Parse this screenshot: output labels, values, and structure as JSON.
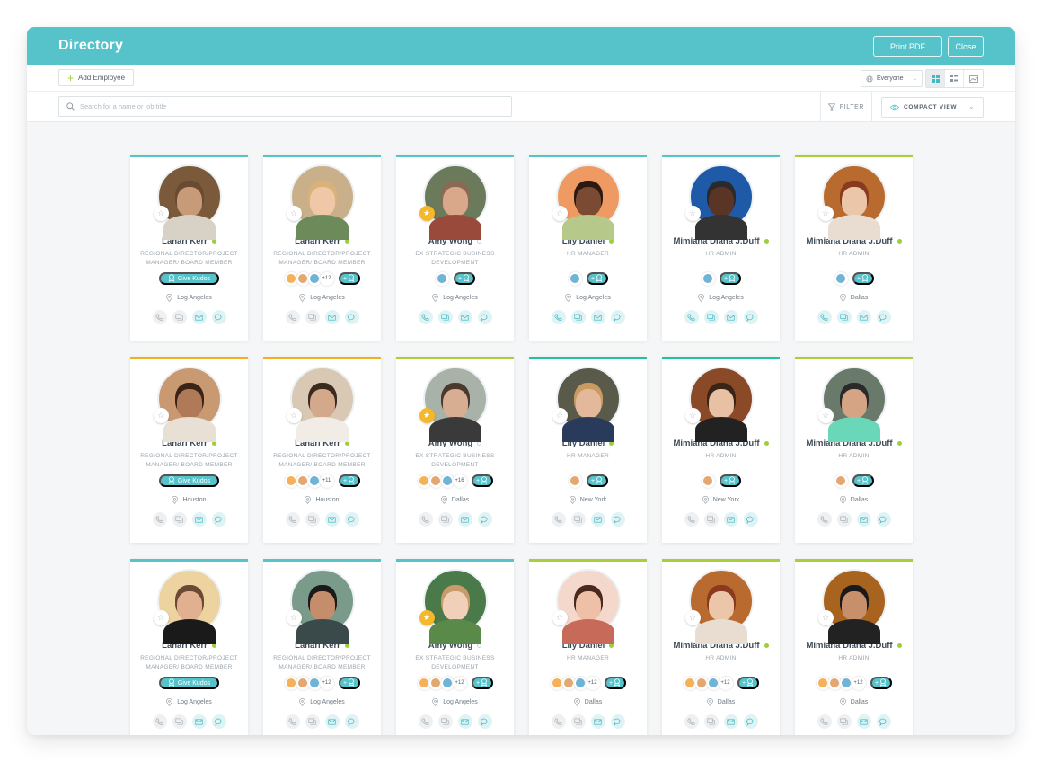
{
  "header": {
    "title": "Directory",
    "print_label": "Print PDF",
    "close_label": "Close"
  },
  "toolbar": {
    "add_employee_label": "Add Employee",
    "audience_selected": "Everyone",
    "view_modes": [
      "grid-large",
      "grid-small",
      "image"
    ],
    "active_view": "grid-large",
    "search_placeholder": "Search for a name or job title",
    "search_value": "",
    "filter_label": "FILTER",
    "view_select_label": "COMPACT VIEW"
  },
  "colors": {
    "brand": "#56c3cb",
    "online": "#9dcf3a",
    "favorite": "#f5b82a",
    "accent_orange": "#f5ae1f",
    "accent_green": "#1fc3a0",
    "accent_lime": "#a9cf38"
  },
  "kudos_button_label": "Give Kudos",
  "cards": [
    {
      "name": "Lahari Kerr",
      "role": "REGIONAL DIRECTOR/PROJECT MANAGER/ BOARD MEMBER",
      "location": "Log Angeles",
      "online": true,
      "favorite": false,
      "accent": "#56c3cb",
      "kudos": "give",
      "badges": [],
      "extra": "",
      "contacts": [
        false,
        false,
        true,
        true
      ],
      "skin": "#c79a78",
      "hair": "#6b4a32",
      "shirt": "#d8d1c5",
      "bg": "#7a5a3a"
    },
    {
      "name": "Lahari Kerr",
      "role": "REGIONAL DIRECTOR/PROJECT MANAGER/ BOARD MEMBER",
      "location": "Log Angeles",
      "online": true,
      "favorite": false,
      "accent": "#56c3cb",
      "kudos": "badges",
      "badges": [
        "orange",
        "tan",
        "blue"
      ],
      "extra": "+12",
      "contacts": [
        false,
        false,
        true,
        true
      ],
      "skin": "#f0c8a8",
      "hair": "#d9b27a",
      "shirt": "#6d8a5a",
      "bg": "#c9b08a"
    },
    {
      "name": "Amy Wong",
      "role": "EX STRATEGIC BUSINESS DEVELOPMENT",
      "location": "Log Angeles",
      "online": false,
      "favorite": true,
      "accent": "#56c3cb",
      "kudos": "badges",
      "badges": [
        "blue"
      ],
      "extra": "",
      "contacts": [
        true,
        true,
        true,
        true
      ],
      "skin": "#d9a88a",
      "hair": "#8a6a55",
      "shirt": "#9a4a3a",
      "bg": "#6a7a5a"
    },
    {
      "name": "Lily Daniel",
      "role": "HR MANAGER",
      "location": "Log Angeles",
      "online": true,
      "favorite": false,
      "accent": "#56c3cb",
      "kudos": "badges",
      "badges": [
        "blue"
      ],
      "extra": "",
      "contacts": [
        true,
        true,
        true,
        true
      ],
      "skin": "#7a4a32",
      "hair": "#2a1a12",
      "shirt": "#b6c98a",
      "bg": "#ef9a62"
    },
    {
      "name": "Mimiana Diana J.Duff",
      "role": "HR ADMIN",
      "location": "Log Angeles",
      "online": true,
      "favorite": false,
      "accent": "#56c3cb",
      "kudos": "badges",
      "badges": [
        "blue"
      ],
      "extra": "",
      "contacts": [
        true,
        true,
        true,
        true
      ],
      "skin": "#5a3424",
      "hair": "#2a2a2a",
      "shirt": "#333333",
      "bg": "#1f5aa8"
    },
    {
      "name": "Mimiana Diana J.Duff",
      "role": "HR ADMIN",
      "location": "Dallas",
      "online": true,
      "favorite": false,
      "accent": "#a9cf38",
      "kudos": "badges",
      "badges": [
        "blue"
      ],
      "extra": "",
      "contacts": [
        true,
        true,
        true,
        true
      ],
      "skin": "#ecc6a8",
      "hair": "#8a3a1e",
      "shirt": "#e8ddd0",
      "bg": "#b96a2e"
    },
    {
      "name": "Lahari Kerr",
      "role": "REGIONAL DIRECTOR/PROJECT MANAGER/ BOARD MEMBER",
      "location": "Houston",
      "online": true,
      "favorite": false,
      "accent": "#f5ae1f",
      "kudos": "give",
      "badges": [],
      "extra": "",
      "contacts": [
        false,
        false,
        true,
        true
      ],
      "skin": "#b07a58",
      "hair": "#3a2418",
      "shirt": "#e8e0d4",
      "bg": "#c99a72"
    },
    {
      "name": "Lahari Kerr",
      "role": "REGIONAL DIRECTOR/PROJECT MANAGER/ BOARD MEMBER",
      "location": "Houston",
      "online": true,
      "favorite": false,
      "accent": "#f5ae1f",
      "kudos": "badges",
      "badges": [
        "orange",
        "tan",
        "blue"
      ],
      "extra": "+11",
      "contacts": [
        false,
        false,
        true,
        true
      ],
      "skin": "#d4a88a",
      "hair": "#3a2a20",
      "shirt": "#f2ece6",
      "bg": "#d8c8b4"
    },
    {
      "name": "Amy Wong",
      "role": "EX STRATEGIC BUSINESS DEVELOPMENT",
      "location": "Dallas",
      "online": false,
      "favorite": true,
      "accent": "#a9cf38",
      "kudos": "badges",
      "badges": [
        "orange",
        "tan",
        "blue"
      ],
      "extra": "+16",
      "contacts": [
        false,
        false,
        true,
        true
      ],
      "skin": "#d8ae92",
      "hair": "#4a3a2e",
      "shirt": "#3a3a3a",
      "bg": "#a8b2a8"
    },
    {
      "name": "Lily Daniel",
      "role": "HR MANAGER",
      "location": "New York",
      "online": true,
      "favorite": false,
      "accent": "#1fc3a0",
      "kudos": "badges",
      "badges": [
        "tan"
      ],
      "extra": "",
      "contacts": [
        false,
        false,
        true,
        true
      ],
      "skin": "#e4b89a",
      "hair": "#c99a62",
      "shirt": "#2a3a5a",
      "bg": "#5a5a4a"
    },
    {
      "name": "Mimiana Diana J.Duff",
      "role": "HR ADMIN",
      "location": "New York",
      "online": true,
      "favorite": false,
      "accent": "#1fc3a0",
      "kudos": "badges",
      "badges": [
        "tan"
      ],
      "extra": "",
      "contacts": [
        false,
        false,
        true,
        true
      ],
      "skin": "#e8c0a4",
      "hair": "#3a2418",
      "shirt": "#222222",
      "bg": "#8a4a28"
    },
    {
      "name": "Mimiana Diana J.Duff",
      "role": "HR ADMIN",
      "location": "Dallas",
      "online": true,
      "favorite": false,
      "accent": "#a9cf38",
      "kudos": "badges",
      "badges": [
        "tan"
      ],
      "extra": "",
      "contacts": [
        false,
        false,
        true,
        true
      ],
      "skin": "#d4a484",
      "hair": "#2a2a2a",
      "shirt": "#6ad8b8",
      "bg": "#6a7a6a"
    },
    {
      "name": "Lahari Kerr",
      "role": "REGIONAL DIRECTOR/PROJECT MANAGER/ BOARD MEMBER",
      "location": "Log Angeles",
      "online": true,
      "favorite": false,
      "accent": "#56c3cb",
      "kudos": "give",
      "badges": [],
      "extra": "",
      "contacts": [
        false,
        false,
        true,
        true
      ],
      "skin": "#e0b090",
      "hair": "#6a4a32",
      "shirt": "#1a1a1a",
      "bg": "#ecd3a0"
    },
    {
      "name": "Lahari Kerr",
      "role": "REGIONAL DIRECTOR/PROJECT MANAGER/ BOARD MEMBER",
      "location": "Log Angeles",
      "online": true,
      "favorite": false,
      "accent": "#56c3cb",
      "kudos": "badges",
      "badges": [
        "orange",
        "tan",
        "blue"
      ],
      "extra": "+12",
      "contacts": [
        false,
        false,
        true,
        true
      ],
      "skin": "#c48e6c",
      "hair": "#1a1a1a",
      "shirt": "#3a4a4a",
      "bg": "#7a9a8a"
    },
    {
      "name": "Amy Wong",
      "role": "EX STRATEGIC BUSINESS DEVELOPMENT",
      "location": "Log Angeles",
      "online": false,
      "favorite": true,
      "accent": "#56c3cb",
      "kudos": "badges",
      "badges": [
        "orange",
        "tan",
        "blue"
      ],
      "extra": "+12",
      "contacts": [
        false,
        false,
        true,
        true
      ],
      "skin": "#f0d0b8",
      "hair": "#c99a6a",
      "shirt": "#5a8a4a",
      "bg": "#4a7a4a"
    },
    {
      "name": "Lily Daniel",
      "role": "HR MANAGER",
      "location": "Dallas",
      "online": true,
      "favorite": false,
      "accent": "#a9cf38",
      "kudos": "badges",
      "badges": [
        "orange",
        "tan",
        "blue"
      ],
      "extra": "+12",
      "contacts": [
        false,
        false,
        true,
        true
      ],
      "skin": "#eec0a8",
      "hair": "#4a2a1e",
      "shirt": "#c86a5a",
      "bg": "#f4d8cc"
    },
    {
      "name": "Mimiana Diana J.Duff",
      "role": "HR ADMIN",
      "location": "Dallas",
      "online": true,
      "favorite": false,
      "accent": "#a9cf38",
      "kudos": "badges",
      "badges": [
        "orange",
        "tan",
        "blue"
      ],
      "extra": "+12",
      "contacts": [
        false,
        false,
        true,
        true
      ],
      "skin": "#ecc6a8",
      "hair": "#8a3a1e",
      "shirt": "#e8ddd0",
      "bg": "#b96a2e"
    },
    {
      "name": "Mimiana Diana J.Duff",
      "role": "HR ADMIN",
      "location": "Dallas",
      "online": true,
      "favorite": false,
      "accent": "#a9cf38",
      "kudos": "badges",
      "badges": [
        "orange",
        "tan",
        "blue"
      ],
      "extra": "+12",
      "contacts": [
        false,
        false,
        true,
        true
      ],
      "skin": "#c8906a",
      "hair": "#1a1a1a",
      "shirt": "#222222",
      "bg": "#a8641e"
    }
  ]
}
